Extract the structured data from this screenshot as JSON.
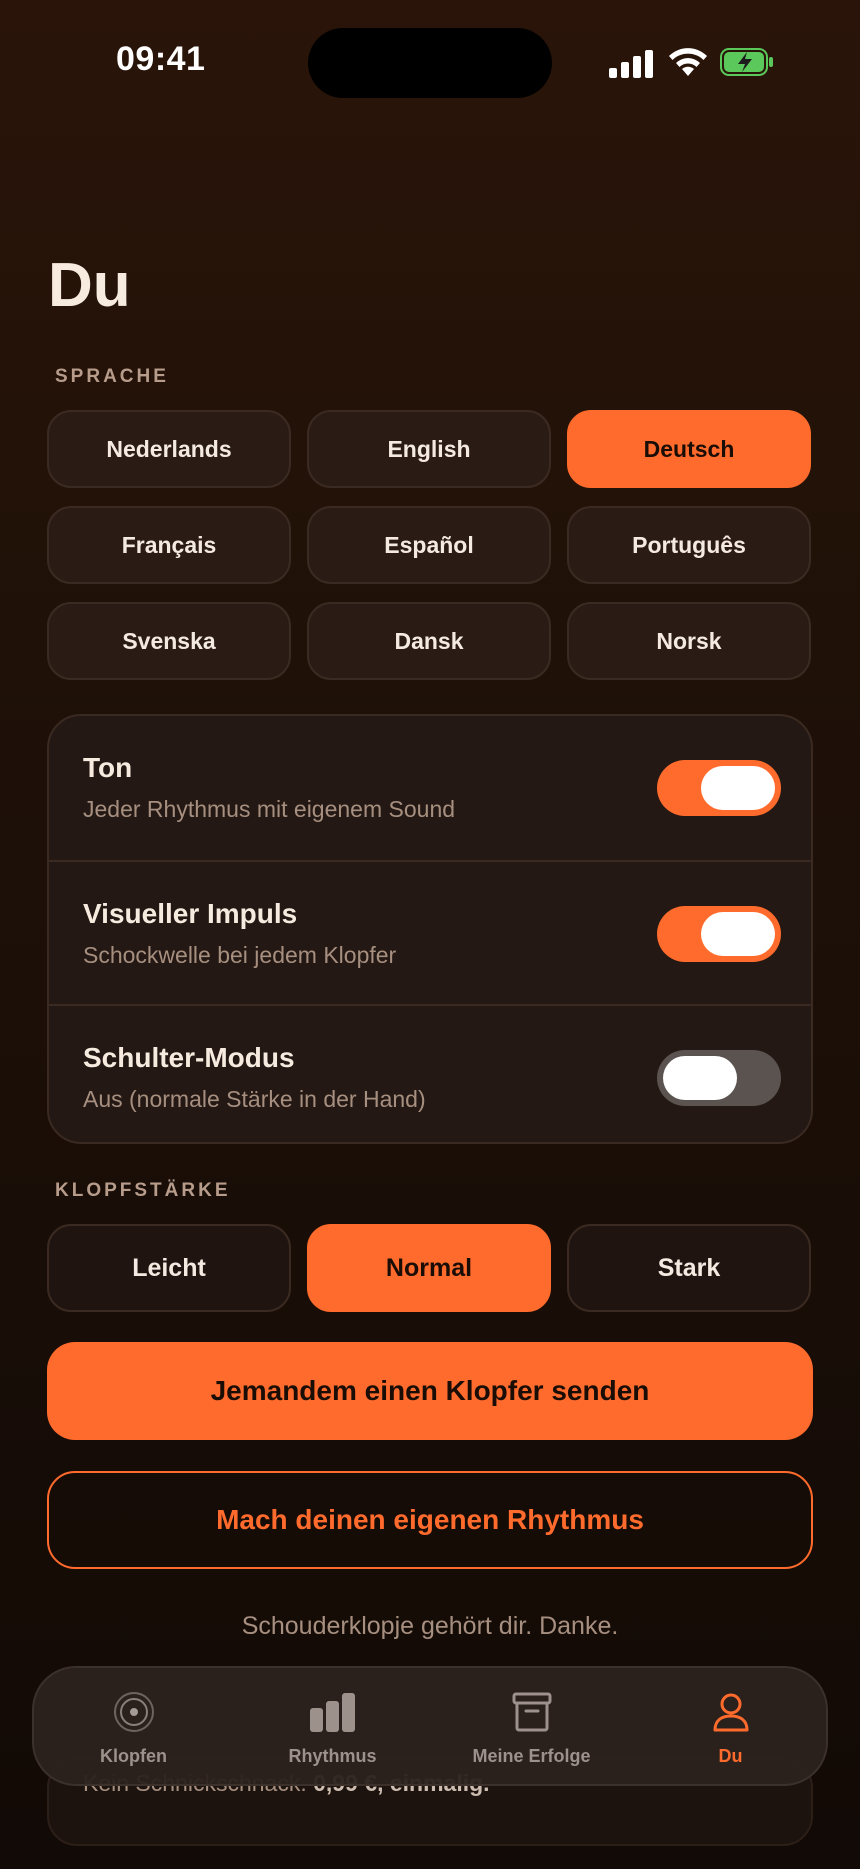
{
  "status": {
    "time": "09:41"
  },
  "page": {
    "title": "Du"
  },
  "language": {
    "section_label": "SPRACHE",
    "options": [
      "Nederlands",
      "English",
      "Deutsch",
      "Français",
      "Español",
      "Português",
      "Svenska",
      "Dansk",
      "Norsk"
    ],
    "selected": "Deutsch"
  },
  "settings": [
    {
      "title": "Ton",
      "subtitle": "Jeder Rhythmus mit eigenem Sound",
      "enabled": true
    },
    {
      "title": "Visueller Impuls",
      "subtitle": "Schockwelle bei jedem Klopfer",
      "enabled": true
    },
    {
      "title": "Schulter-Modus",
      "subtitle": "Aus (normale Stärke in der Hand)",
      "enabled": false
    }
  ],
  "strength": {
    "section_label": "KLOPFSTÄRKE",
    "options": [
      "Leicht",
      "Normal",
      "Stark"
    ],
    "selected": "Normal"
  },
  "actions": {
    "send_label": "Jemandem einen Klopfer senden",
    "own_rhythm_label": "Mach deinen eigenen Rhythmus"
  },
  "thanks_text": "Schouderklopje gehört dir. Danke.",
  "purchase": {
    "text_prefix": "Kein Schnickschnack.",
    "text_price": "0,99 €, einmalig."
  },
  "tabs": [
    {
      "label": "Klopfen",
      "icon": "target-icon",
      "active": false
    },
    {
      "label": "Rhythmus",
      "icon": "bars-icon",
      "active": false
    },
    {
      "label": "Meine Erfolge",
      "icon": "archive-box-icon",
      "active": false
    },
    {
      "label": "Du",
      "icon": "person-icon",
      "active": true
    }
  ],
  "colors": {
    "accent": "#ff6b2c",
    "background": "#1a0f09",
    "battery_green": "#5ac85a"
  }
}
